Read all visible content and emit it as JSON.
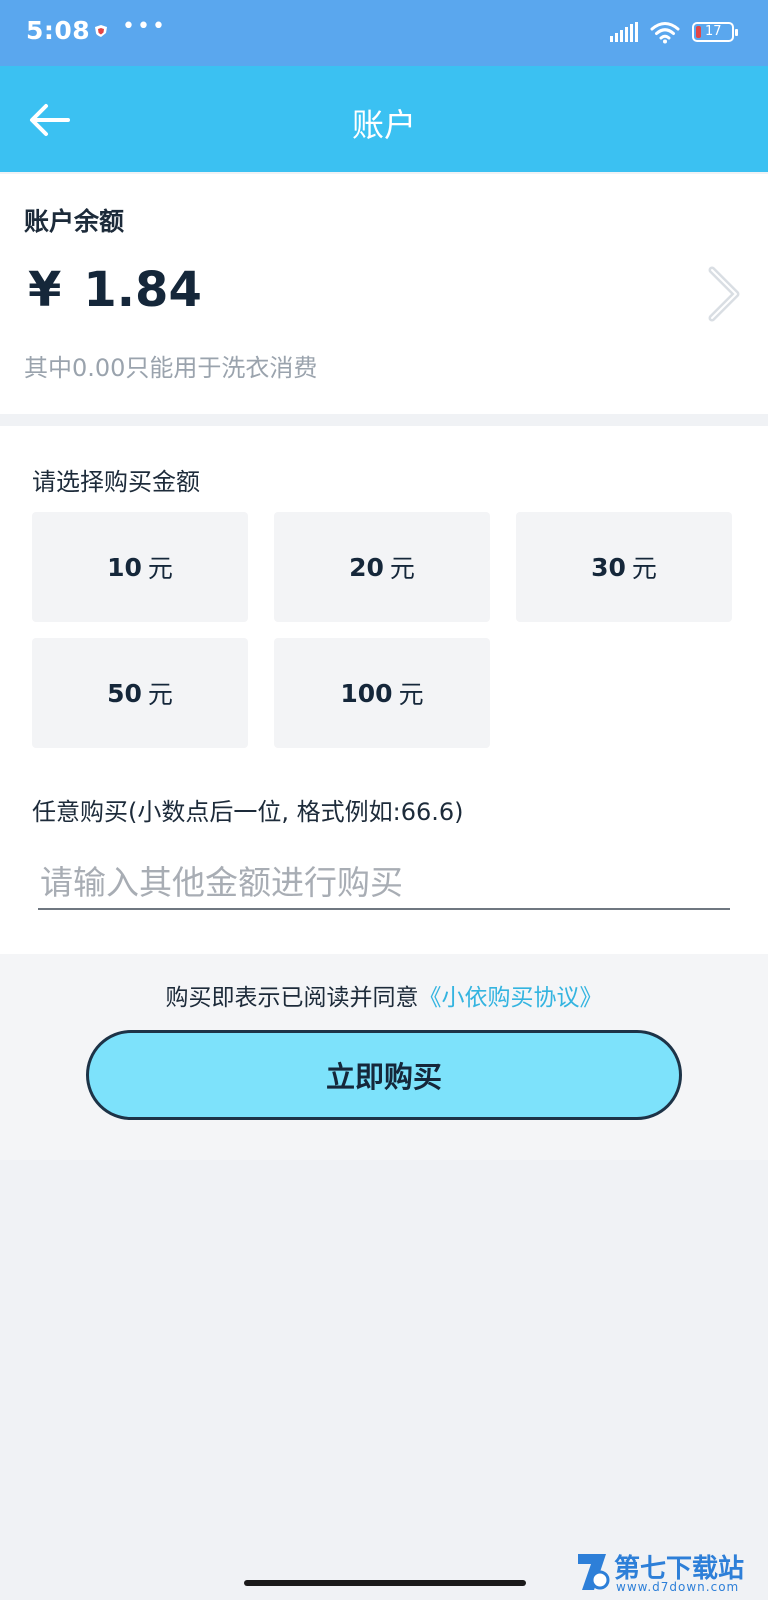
{
  "status_bar": {
    "time": "5:08",
    "dots": "•••",
    "battery": "17"
  },
  "header": {
    "title": "账户",
    "back_icon": "arrow-left-icon"
  },
  "balance": {
    "heading": "账户余额",
    "currency": "¥",
    "amount": "1.84",
    "note": "其中0.00只能用于洗衣消费",
    "chevron_icon": "chevron-right-icon"
  },
  "purchase": {
    "heading": "请选择购买金额",
    "options": [
      {
        "value": "10",
        "unit": "元"
      },
      {
        "value": "20",
        "unit": "元"
      },
      {
        "value": "30",
        "unit": "元"
      },
      {
        "value": "50",
        "unit": "元"
      },
      {
        "value": "100",
        "unit": "元"
      }
    ],
    "custom_label": "任意购买(小数点后一位, 格式例如:66.6)",
    "custom_placeholder": "请输入其他金额进行购买",
    "custom_value": ""
  },
  "agreement": {
    "text": "购买即表示已阅读并同意",
    "link": "《小依购买协议》"
  },
  "buy_button": {
    "label": "立即购买"
  },
  "watermark": {
    "title": "第七下载站",
    "url": "www.d7down.com"
  },
  "colors": {
    "status_bar": "#5aa7ee",
    "title_bar": "#3bc1f2",
    "button": "#7de2fb",
    "link": "#34b4e0"
  }
}
